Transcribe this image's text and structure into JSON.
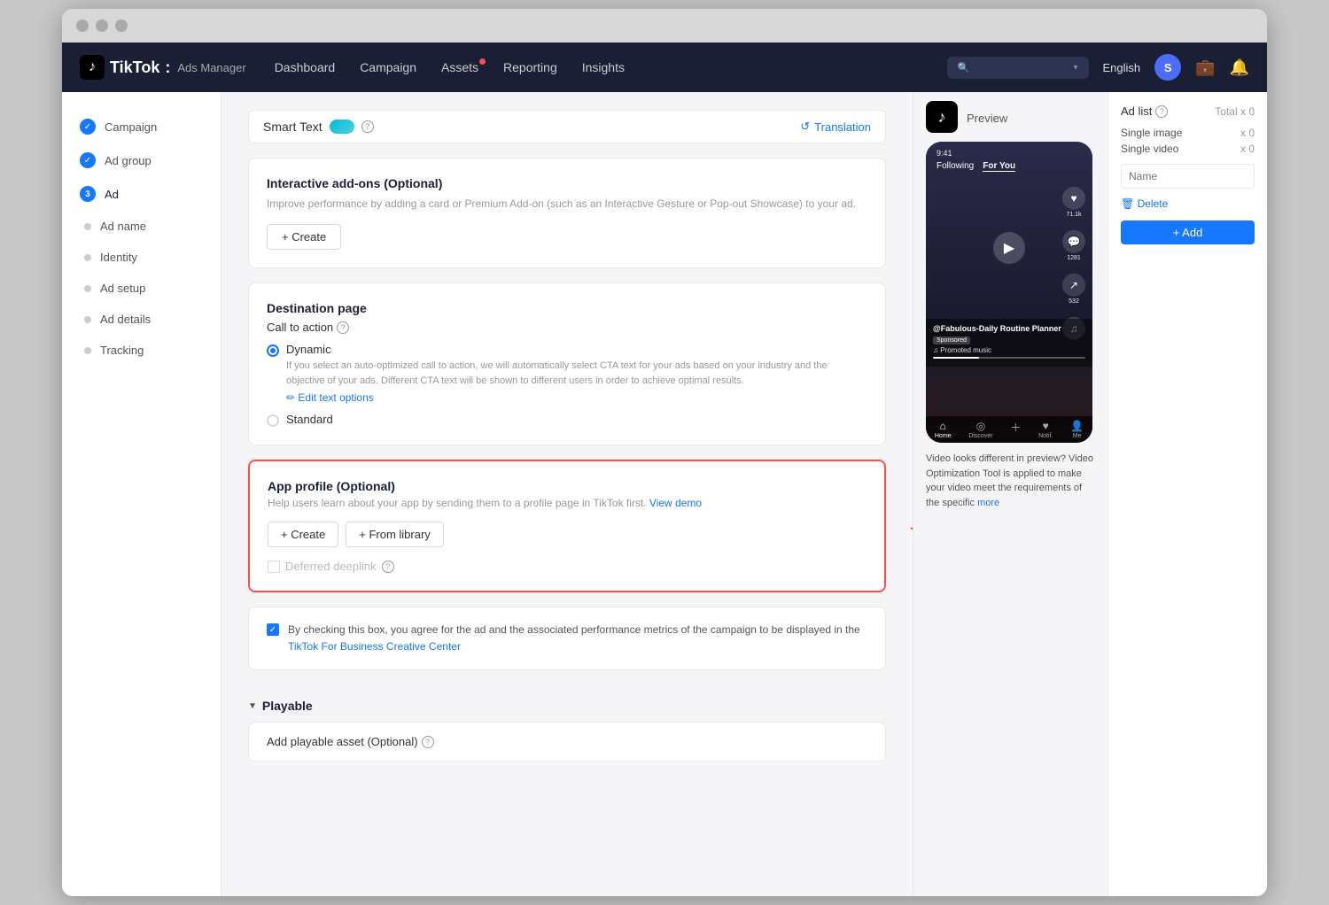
{
  "browser": {
    "dots": [
      "dot1",
      "dot2",
      "dot3"
    ]
  },
  "navbar": {
    "brand": "TikTok",
    "brand_colon": ":",
    "brand_sub": "Ads Manager",
    "links": [
      {
        "label": "Dashboard",
        "badge": false
      },
      {
        "label": "Campaign",
        "badge": false
      },
      {
        "label": "Assets",
        "badge": true
      },
      {
        "label": "Reporting",
        "badge": false
      },
      {
        "label": "Insights",
        "badge": false
      }
    ],
    "search_placeholder": "Search",
    "language": "English",
    "avatar_letter": "S"
  },
  "sidebar": {
    "items": [
      {
        "label": "Campaign",
        "type": "check"
      },
      {
        "label": "Ad group",
        "type": "check"
      },
      {
        "label": "Ad",
        "type": "number",
        "num": "3"
      },
      {
        "label": "Ad name",
        "type": "dot"
      },
      {
        "label": "Identity",
        "type": "dot"
      },
      {
        "label": "Ad setup",
        "type": "dot"
      },
      {
        "label": "Ad details",
        "type": "dot"
      },
      {
        "label": "Tracking",
        "type": "dot"
      }
    ]
  },
  "smart_text": {
    "label": "Smart Text",
    "toggle": "on",
    "translation_label": "Translation",
    "translation_icon": "↺"
  },
  "interactive_addons": {
    "title": "Interactive add-ons (Optional)",
    "desc": "Improve performance by adding a card or Premium Add-on (such as an Interactive Gesture or Pop-out Showcase) to your ad.",
    "create_btn": "+ Create"
  },
  "destination_page": {
    "title": "Destination page",
    "cta_label": "Call to action",
    "cta_info": "?",
    "dynamic_label": "Dynamic",
    "dynamic_desc": "If you select an auto-optimized call to action, we will automatically select CTA text for your ads based on your industry and the objective of your ads. Different CTA text will be shown to different users in order to achieve optimal results.",
    "edit_link": "✏ Edit text options",
    "standard_label": "Standard"
  },
  "app_profile": {
    "title": "App profile (Optional)",
    "desc": "Help users learn about your app by sending them to a profile page in TikTok first.",
    "view_demo": "View demo",
    "create_btn": "+ Create",
    "library_btn": "+ From library",
    "deferred_label": "Deferred deeplink",
    "deferred_info": "?"
  },
  "consent_checkbox": {
    "checked": true,
    "text": "By checking this box, you agree for the ad and the associated performance metrics of the campaign to be displayed in the",
    "link_text": "TikTok For Business Creative Center"
  },
  "playable": {
    "title": "Playable",
    "asset_label": "Add playable asset (Optional)",
    "asset_info": "?"
  },
  "preview": {
    "tiktok_icon": "♪",
    "label": "Preview",
    "following": "Following",
    "for_you": "For You",
    "username": "@Fabulous-Daily Routine Planner",
    "sponsored": "Sponsored",
    "promoted_music": "♫ Promoted music",
    "nav_items": [
      {
        "label": "Home",
        "icon": "⌂"
      },
      {
        "label": "Discover",
        "icon": "◎"
      },
      {
        "label": "+",
        "icon": "+"
      },
      {
        "label": "Notifications",
        "icon": "♥"
      },
      {
        "label": "Me",
        "icon": "👤"
      }
    ],
    "notice": "Video looks different in preview? Video Optimization Tool is applied to make your video meet the requirements of the specific",
    "more_link": "more"
  },
  "ad_list": {
    "title": "Ad list",
    "info": "?",
    "total_label": "Total x 0",
    "rows": [
      {
        "label": "Single image",
        "count": "x 0"
      },
      {
        "label": "Single video",
        "count": "x 0"
      }
    ],
    "name_placeholder": "Name",
    "delete_btn": "🗑 Delete",
    "add_btn": "+ Add"
  }
}
